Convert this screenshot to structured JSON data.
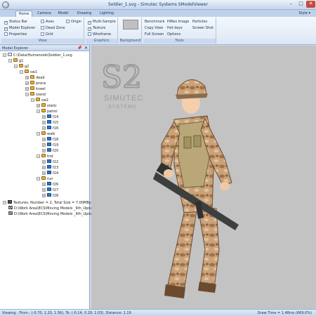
{
  "window": {
    "title": "Soldier_1.svg - Simutec Systems SModelViewer",
    "controls": {
      "minimize": "–",
      "maximize": "□",
      "close": "✕"
    }
  },
  "ribbon_tabs": {
    "tabs": [
      {
        "label": "Home",
        "active": true
      },
      {
        "label": "Camera",
        "active": false
      },
      {
        "label": "Model",
        "active": false
      },
      {
        "label": "Drawing",
        "active": false
      },
      {
        "label": "Lighting",
        "active": false
      }
    ],
    "style_menu": "Style ▾"
  },
  "ribbon": {
    "view": {
      "label": "View",
      "status_bar": {
        "label": "Status Bar",
        "checked": true
      },
      "model_explorer": {
        "label": "Model Explorer",
        "checked": true
      },
      "properties": {
        "label": "Properties",
        "checked": false
      },
      "axes": {
        "label": "Axes",
        "checked": false
      },
      "dead_zone": {
        "label": "Dead Zone",
        "checked": false
      },
      "grid": {
        "label": "Grid",
        "checked": false
      },
      "origin": {
        "label": "Origin",
        "checked": false
      }
    },
    "graphics": {
      "label": "Graphics",
      "multi_sample": {
        "label": "Multi-Sample",
        "checked": true
      },
      "texture": {
        "label": "Texture",
        "checked": true
      },
      "wireframe": {
        "label": "Wireframe",
        "checked": false
      }
    },
    "background": {
      "label": "Background",
      "swatch_color": "#c0c0c0"
    },
    "tools": {
      "label": "Tools",
      "benchmark": "Benchmark",
      "copy_view": "Copy View",
      "full_screen": "Full Screen",
      "hifiles_image": "HiRes Image",
      "hot_keys": "Hot keys",
      "options": "Options",
      "particles": "Particles",
      "screen_shot": "Screen Shot"
    }
  },
  "explorer": {
    "title": "Model Explorer",
    "pin": "📌",
    "close": "✕",
    "root": "C:\\Data\\Humanoids\\Soldier_1.svg",
    "nodes": {
      "g1": "g1",
      "g2": "g2",
      "sw1": "sw1",
      "dead": "dead",
      "prone": "prone",
      "kneel": "kneel",
      "stand": "stand",
      "sw2": "sw2",
      "static": "static",
      "patrol": "patrol",
      "f14": "f14",
      "f15": "f15",
      "f16": "f16",
      "walk": "walk",
      "f18": "f18",
      "f19": "f19",
      "f20": "f20",
      "trot": "trot",
      "f22": "f22",
      "f23": "f23",
      "f24": "f24",
      "run": "run",
      "f26": "f26",
      "f27": "f27",
      "f28": "f28"
    },
    "textures_summary": "Textures: Number = 2, Total Size = 7.00MBytes",
    "texture_files": [
      "D:\\Work Area\\ECS\\Moving Models _9th_Update",
      "D:\\Work Area\\ECS\\Moving Models _9th_Update"
    ]
  },
  "viewport": {
    "background_color": "#c3c3c3",
    "logo_initials": "S2",
    "logo_name": "SIMUTEC",
    "logo_sub": "SYSTEMS"
  },
  "status": {
    "left": "Viewing : From : (-0.70, 1.20, 1.56), To: (-0.14, 0.29, 1.03), Distance: 1.19",
    "right": "Draw Time = 1.48ms (669.0%)"
  }
}
